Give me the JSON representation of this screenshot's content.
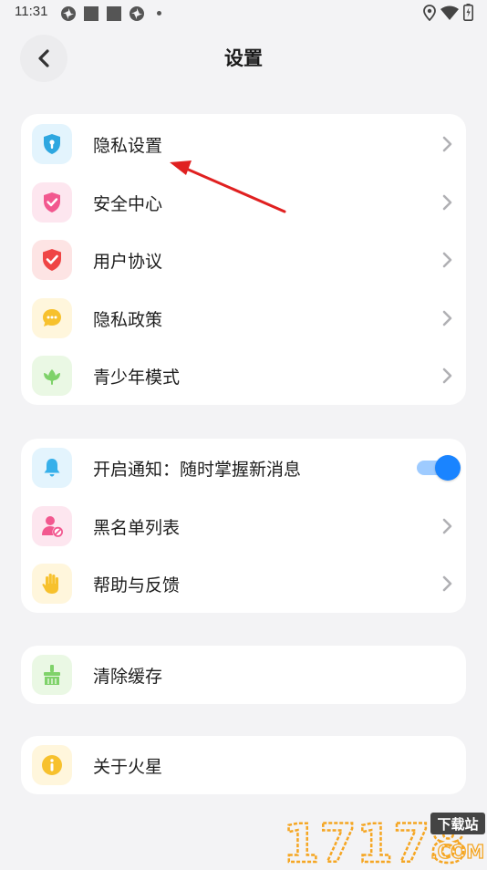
{
  "status_bar": {
    "time": "11:31",
    "left_icons": [
      "pinwheel-icon",
      "square-icon",
      "square-icon",
      "pinwheel-icon",
      "dot-icon"
    ],
    "right_icons": [
      "location-icon",
      "wifi-icon",
      "battery-icon"
    ]
  },
  "header": {
    "title": "设置",
    "back_icon": "chevron-left-icon"
  },
  "groups": [
    {
      "items": [
        {
          "label": "隐私设置",
          "icon": "lock-shield-icon",
          "icon_color": "#2ea7e0",
          "bg": "#e3f4fd"
        },
        {
          "label": "安全中心",
          "icon": "check-shield-icon",
          "icon_color": "#f2588f",
          "bg": "#fde6ef"
        },
        {
          "label": "用户协议",
          "icon": "check-shield-icon",
          "icon_color": "#ef4545",
          "bg": "#fde4e4"
        },
        {
          "label": "隐私政策",
          "icon": "chat-bubble-icon",
          "icon_color": "#f7c12d",
          "bg": "#fff6dc"
        },
        {
          "label": "青少年模式",
          "icon": "sprout-icon",
          "icon_color": "#7fd26a",
          "bg": "#eaf8e4"
        }
      ]
    },
    {
      "items": [
        {
          "label": "开启通知：随时掌握新消息",
          "icon": "bell-icon",
          "icon_color": "#37b0ea",
          "bg": "#e3f4fd",
          "toggle": true
        },
        {
          "label": "黑名单列表",
          "icon": "user-block-icon",
          "icon_color": "#f2588f",
          "bg": "#fde6ef"
        },
        {
          "label": "帮助与反馈",
          "icon": "hand-icon",
          "icon_color": "#f7c12d",
          "bg": "#fff6dc"
        }
      ]
    },
    {
      "items": [
        {
          "label": "清除缓存",
          "icon": "broom-icon",
          "icon_color": "#7fd26a",
          "bg": "#eaf8e4"
        }
      ]
    },
    {
      "items": [
        {
          "label": "关于火星",
          "icon": "info-icon",
          "icon_color": "#f7c12d",
          "bg": "#fff6dc"
        }
      ]
    }
  ],
  "notification_enabled": true,
  "colors": {
    "accent": "#1a84ff",
    "annotation_arrow": "#e02020",
    "watermark_orange": "#f5a623"
  },
  "watermark": {
    "number": "17178",
    "tag": "下载站",
    "domain": ".COM"
  }
}
